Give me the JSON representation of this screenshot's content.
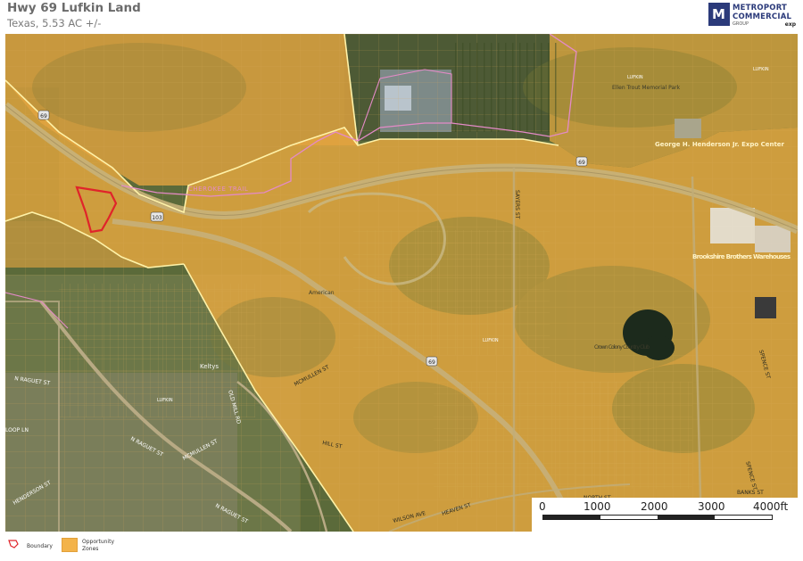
{
  "header": {
    "title": "Hwy 69 Lufkin Land",
    "subtitle": "Texas, 5.53 AC +/-"
  },
  "logo": {
    "mark": "M",
    "line1": "METROPORT",
    "line2": "COMMERCIAL",
    "line3": "GROUP",
    "line4": "exp"
  },
  "map": {
    "labels": {
      "cherokee_trail": "CHEROKEE TRAIL",
      "ellen_trout": "Ellen Trout Memorial Park",
      "george_henderson": "George H. Henderson Jr. Expo Center",
      "brookshire": "Brookshire Brothers Warehouses",
      "american": "American",
      "crown_colony": "Crown Colony Country Club",
      "keltys": "Keltys",
      "lufkin_1": "LUFKIN",
      "lufkin_2": "LUFKIN",
      "lufkin_3": "LUFKIN",
      "lufkin_4": "LUFKIN",
      "hwy_103": "103",
      "hwy_69_a": "69",
      "hwy_69_b": "69",
      "hwy_69_c": "69",
      "mcmullen_st_1": "MCMULLEN ST",
      "mcmullen_st_2": "MCMULLEN ST",
      "raguet_st_1": "N RAGUET ST",
      "raguet_st_2": "N RAGUET ST",
      "raguet_st_3": "N RAGUET ST",
      "henderson_st": "HENDERSON ST",
      "loop_ln": "LOOP LN",
      "old_mill_rd": "OLD MILL RD",
      "banks_st": "BANKS ST",
      "spence_st_1": "SPENCE ST",
      "spence_st_2": "SPENCE ST",
      "hill_st": "HILL ST",
      "sayers_st": "SAYERS ST",
      "heaven_st": "HEAVEN ST",
      "wilson_ave": "WILSON AVE",
      "north_st": "NORTH ST"
    },
    "colors": {
      "opportunity_zone": "#f3b34a",
      "boundary": "#e0242a",
      "zone_border": "#fff6b8",
      "parcel_lines": "#c9a050",
      "pink_boundary": "#e48ac7"
    }
  },
  "scale": {
    "ticks": [
      "0",
      "1000",
      "2000",
      "3000",
      "4000ft"
    ]
  },
  "legend": {
    "boundary_label": "Boundary",
    "zones_label_1": "Opportunity",
    "zones_label_2": "Zones"
  }
}
